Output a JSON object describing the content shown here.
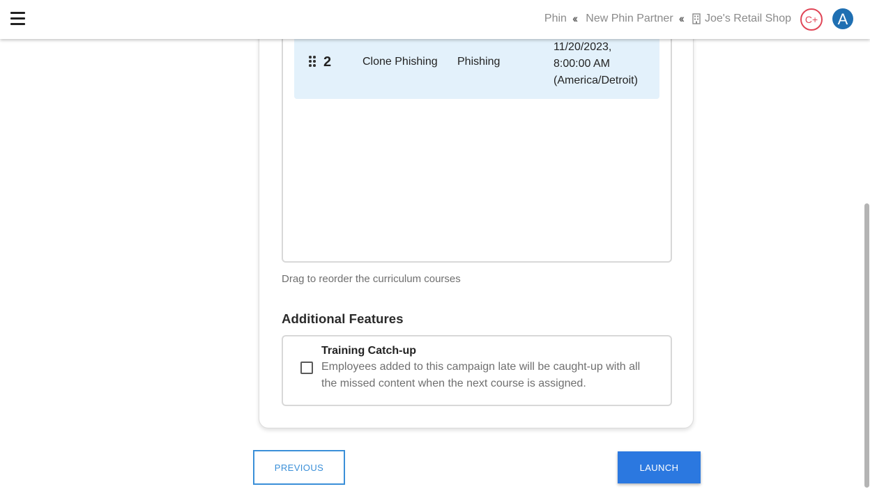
{
  "header": {
    "menu_icon": "hamburger-icon",
    "breadcrumbs": [
      {
        "label": "Phin"
      },
      {
        "label": "New Phin Partner"
      },
      {
        "label": "Joe's Retail Shop",
        "icon": "building-icon"
      }
    ],
    "separator_icon": "double-chevron-left-icon",
    "badge_label": "C+",
    "badge_color": "#e04556",
    "avatar_initial": "A",
    "avatar_color": "#1f6fb2"
  },
  "curriculum": {
    "courses": [
      {
        "position": "2",
        "name": "Clone Phishing",
        "type": "Phishing",
        "date_line1": "11/20/2023,",
        "date_line2": "8:00:00 AM",
        "date_line3": "(America/Detroit)"
      }
    ],
    "hint": "Drag to reorder the curriculum courses"
  },
  "additional_features": {
    "title": "Additional Features",
    "items": [
      {
        "title": "Training Catch-up",
        "description": "Employees added to this campaign late will be caught-up with all the missed content when the next course is assigned.",
        "checked": false
      }
    ]
  },
  "actions": {
    "previous_label": "PREVIOUS",
    "launch_label": "LAUNCH",
    "accent_color": "#2b78e0"
  }
}
